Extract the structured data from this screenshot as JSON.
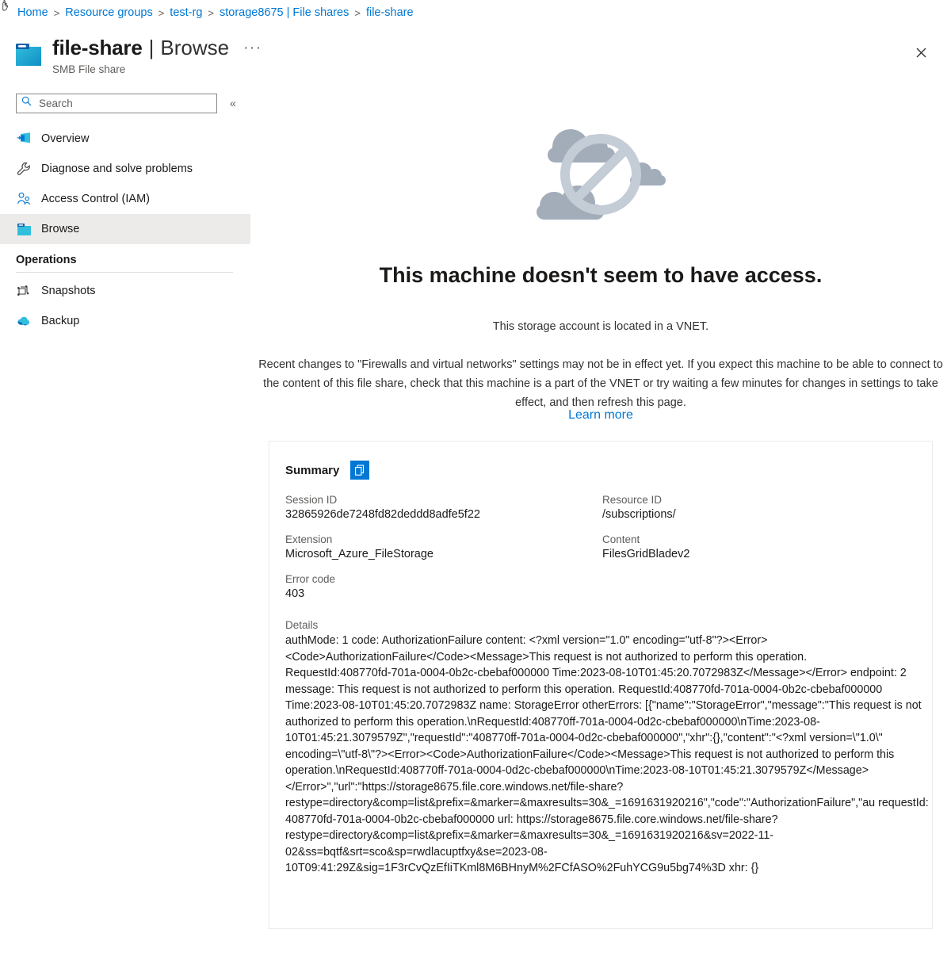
{
  "breadcrumb": {
    "separator": ">",
    "items": [
      {
        "label": "Home"
      },
      {
        "label": "Resource groups"
      },
      {
        "label": "test-rg"
      },
      {
        "label": "storage8675 | File shares"
      },
      {
        "label": "file-share"
      }
    ]
  },
  "header": {
    "resource_name": "file-share",
    "pipe": "|",
    "section": "Browse",
    "more_label": "···",
    "subtitle": "SMB File share",
    "close_label": "✕",
    "icon": "file-share-folder-icon"
  },
  "sidebar": {
    "search": {
      "placeholder": "Search",
      "value": "",
      "icon": "search-icon"
    },
    "collapse": {
      "label": "«",
      "icon": "chevron-double-left-icon"
    },
    "items": [
      {
        "label": "Overview",
        "icon": "overview-icon",
        "selected": false
      },
      {
        "label": "Diagnose and solve problems",
        "icon": "wrench-icon",
        "selected": false
      },
      {
        "label": "Access Control (IAM)",
        "icon": "people-icon",
        "selected": false
      },
      {
        "label": "Browse",
        "icon": "folder-icon",
        "selected": true
      }
    ],
    "groups": [
      {
        "title": "Operations",
        "items": [
          {
            "label": "Snapshots",
            "icon": "snapshots-icon"
          },
          {
            "label": "Backup",
            "icon": "backup-cloud-icon"
          }
        ]
      }
    ]
  },
  "main": {
    "illustration": "no-access-clouds-icon",
    "error_title": "This machine doesn't seem to have access.",
    "error_subtitle": "This storage account is located in a VNET.",
    "error_body": "Recent changes to \"Firewalls and virtual networks\" settings may not be in effect yet. If you expect this machine to be able to connect to the content of this file share, check that this machine is a part of the VNET or try waiting a few minutes for changes in settings to take effect, and then refresh this page.",
    "learn_more": "Learn more"
  },
  "summary": {
    "title": "Summary",
    "copy_icon": "copy-icon",
    "fields": [
      {
        "label": "Session ID",
        "value": "32865926de7248fd82deddd8adfe5f22"
      },
      {
        "label": "Resource ID",
        "value": "/subscriptions/"
      },
      {
        "label": "Extension",
        "value": "Microsoft_Azure_FileStorage"
      },
      {
        "label": "Content",
        "value": "FilesGridBladev2"
      },
      {
        "label": "Error code",
        "value": "403"
      }
    ],
    "details_label": "Details",
    "details_text": "authMode: 1 code: AuthorizationFailure content: <?xml version=\"1.0\" encoding=\"utf-8\"?><Error><Code>AuthorizationFailure</Code><Message>This request is not authorized to perform this operation.\nRequestId:408770fd-701a-0004-0b2c-cbebaf000000 Time:2023-08-10T01:45:20.7072983Z</Message></Error> endpoint: 2 message: This request is not authorized to perform this operation. RequestId:408770fd-701a-0004-0b2c-cbebaf000000 Time:2023-08-10T01:45:20.7072983Z name: StorageError otherErrors: [{\"name\":\"StorageError\",\"message\":\"This request is not authorized to perform this operation.\\nRequestId:408770ff-701a-0004-0d2c-cbebaf000000\\nTime:2023-08-10T01:45:21.3079579Z\",\"requestId\":\"408770ff-701a-0004-0d2c-cbebaf000000\",\"xhr\":{},\"content\":\"<?xml version=\\\"1.0\\\" encoding=\\\"utf-8\\\"?><Error><Code>AuthorizationFailure</Code><Message>This request is not authorized to perform this operation.\\nRequestId:408770ff-701a-0004-0d2c-cbebaf000000\\nTime:2023-08-10T01:45:21.3079579Z</Message></Error>\",\"url\":\"https://storage8675.file.core.windows.net/file-share?restype=directory&comp=list&prefix=&marker=&maxresults=30&_=1691631920216\",\"code\":\"AuthorizationFailure\",\"au requestId: 408770fd-701a-0004-0b2c-cbebaf000000 url: https://storage8675.file.core.windows.net/file-share?restype=directory&comp=list&prefix=&marker=&maxresults=30&_=1691631920216&sv=2022-11-02&ss=bqtf&srt=sco&sp=rwdlacuptfxy&se=2023-08-10T09:41:29Z&sig=1F3rCvQzEfIiTKml8M6BHnyM%2FCfASO%2FuhYCG9u5bg74%3D xhr: {}"
  },
  "colors": {
    "link": "#0078d4",
    "accent": "#0078d4",
    "selected_bg": "#edebe9",
    "illustration": "#a3adba"
  }
}
